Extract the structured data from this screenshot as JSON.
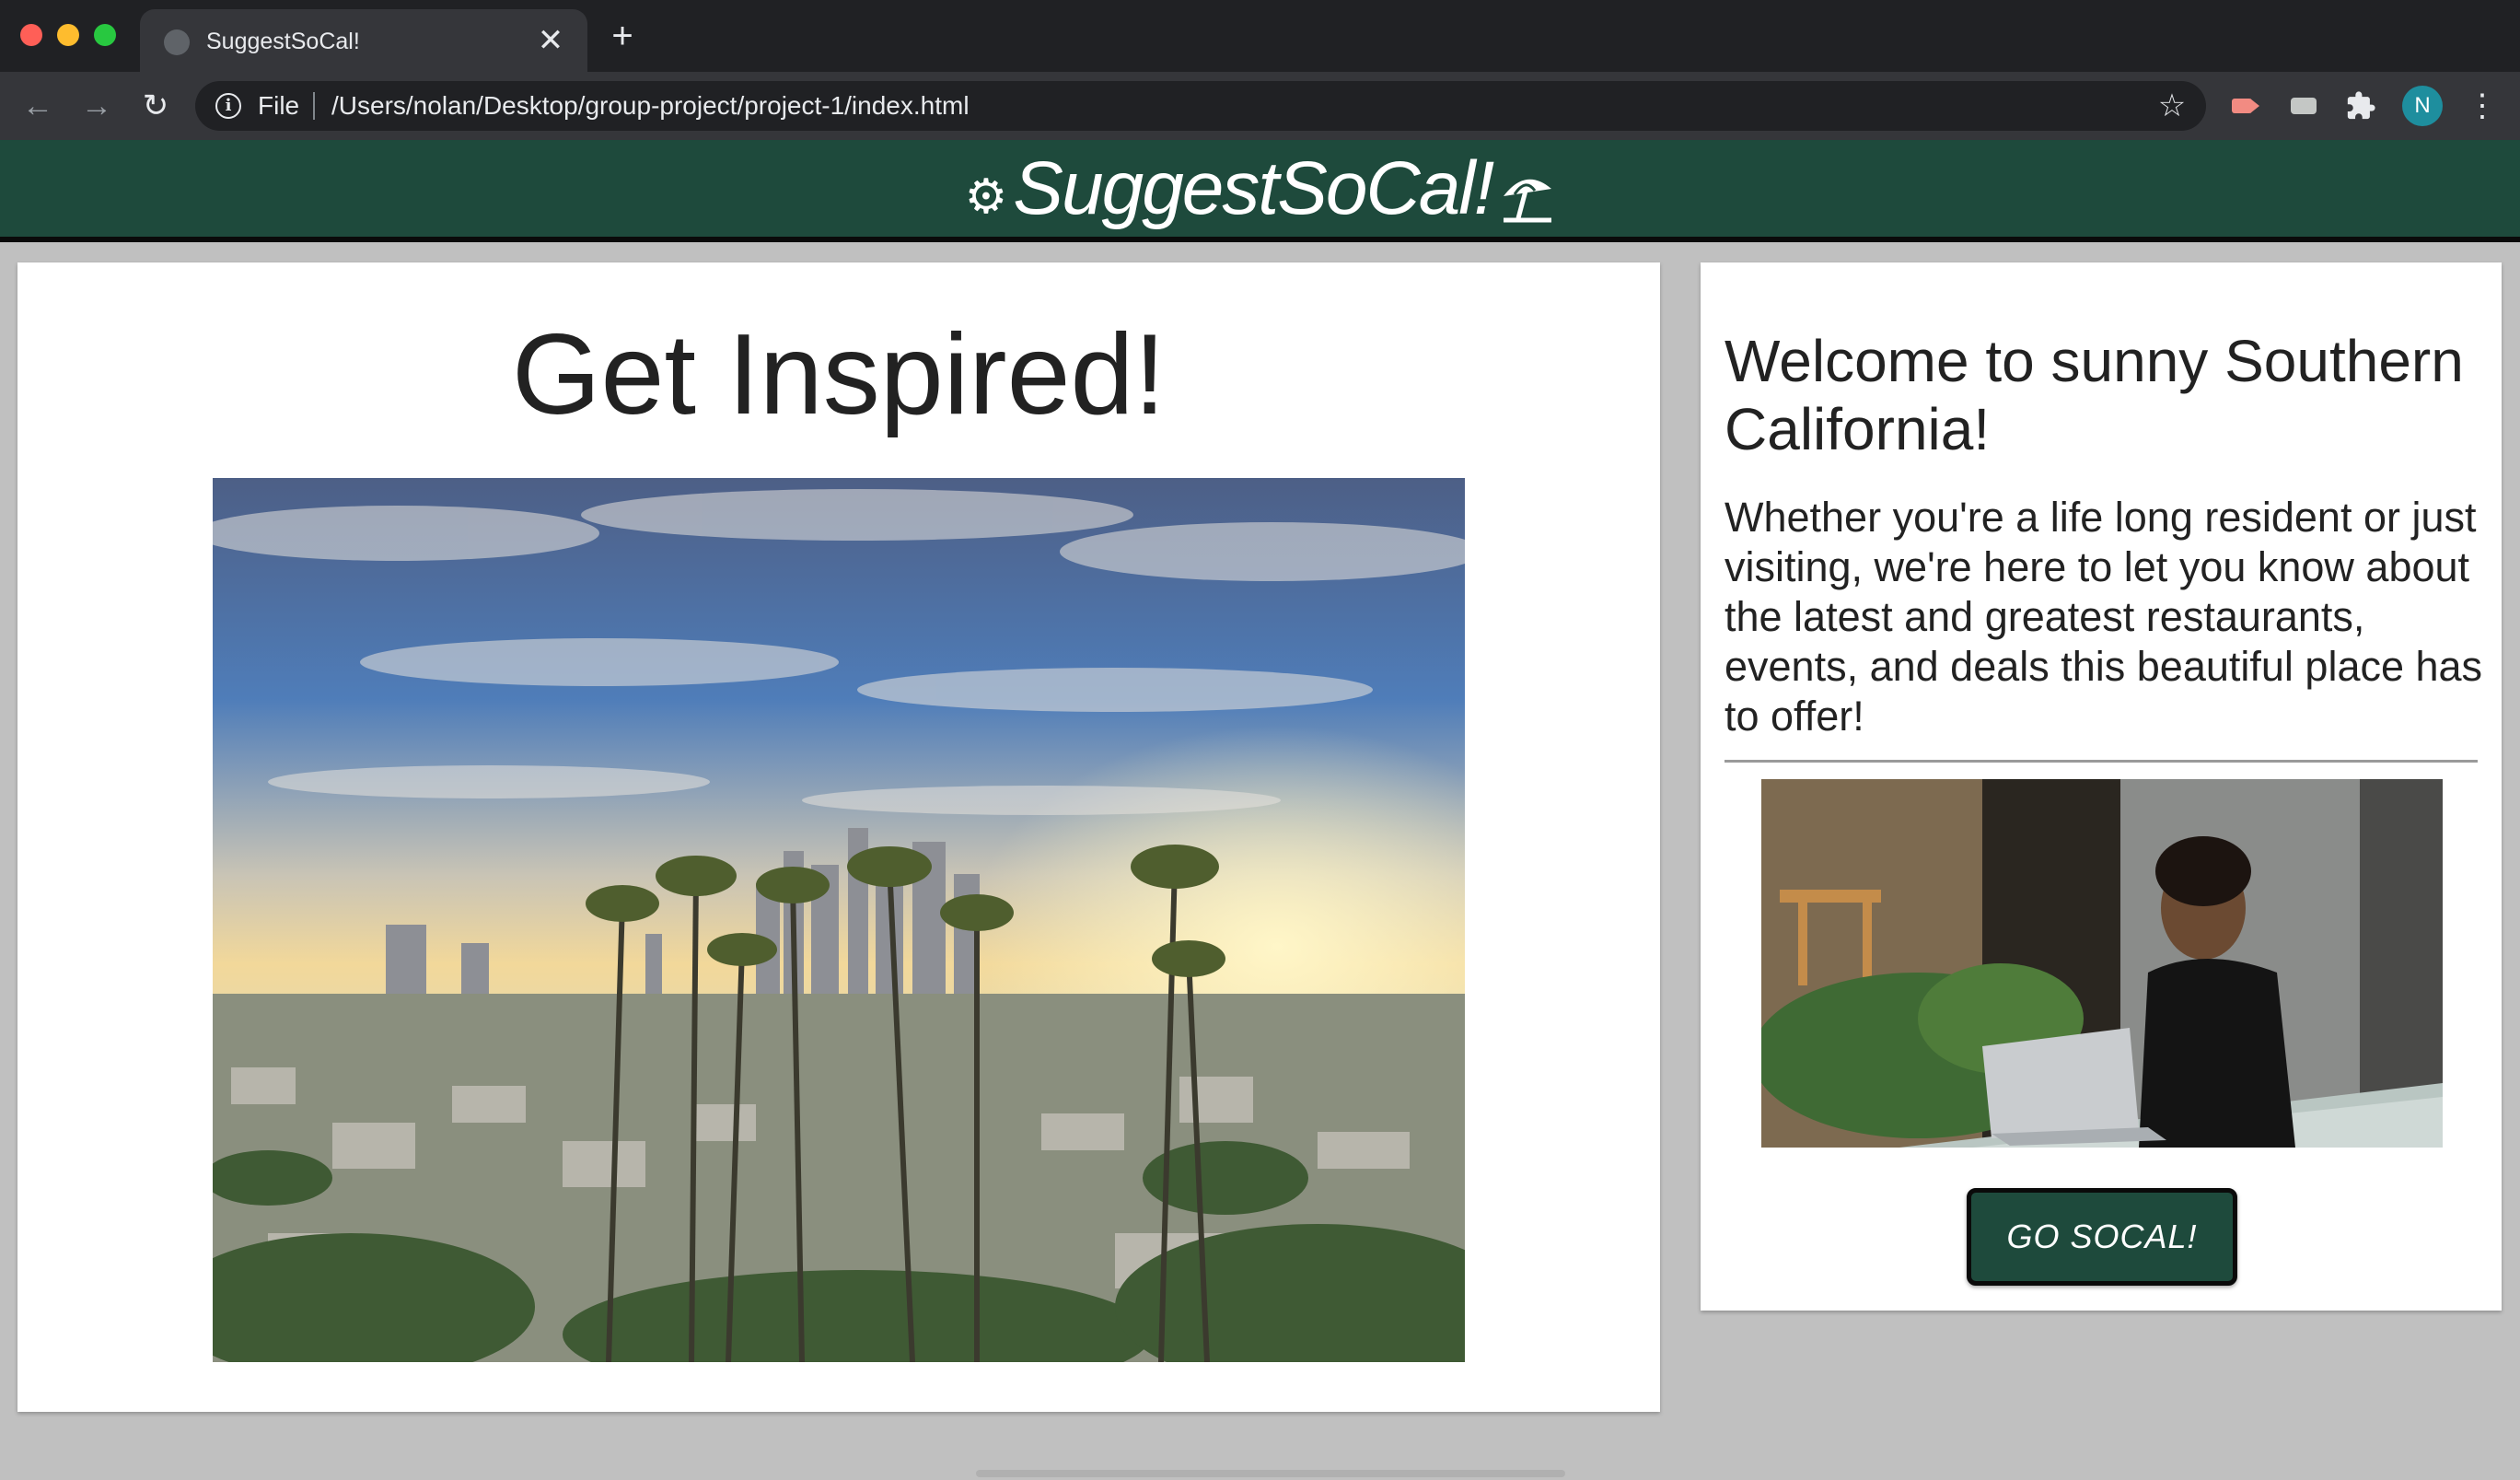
{
  "browser": {
    "tab_title": "SuggestSoCal!",
    "tab_close": "✕",
    "new_tab": "+",
    "url_scheme_label": "File",
    "url": "/Users/nolan/Desktop/group-project/project-1/index.html",
    "profile_initial": "N"
  },
  "site": {
    "brand": "SuggestSoCal!",
    "brand_color": "#1e4a3c"
  },
  "main": {
    "heading": "Get Inspired!"
  },
  "sidebar": {
    "heading": "Welcome to sunny Southern California!",
    "body": "Whether you're a life long resident or just visiting, we're here to let you know about the latest and greatest restaurants, events, and deals this beautiful place has to offer!",
    "button_label": "GO SOCAL!"
  },
  "icons": {
    "back": "back-arrow-icon",
    "forward": "forward-arrow-icon",
    "reload": "reload-icon",
    "info": "info-icon",
    "star": "bookmark-star-icon",
    "extensions": "puzzle-icon",
    "menu": "kebab-menu-icon",
    "brand_left": "gear-icon",
    "brand_right": "beach-umbrella-icon"
  }
}
